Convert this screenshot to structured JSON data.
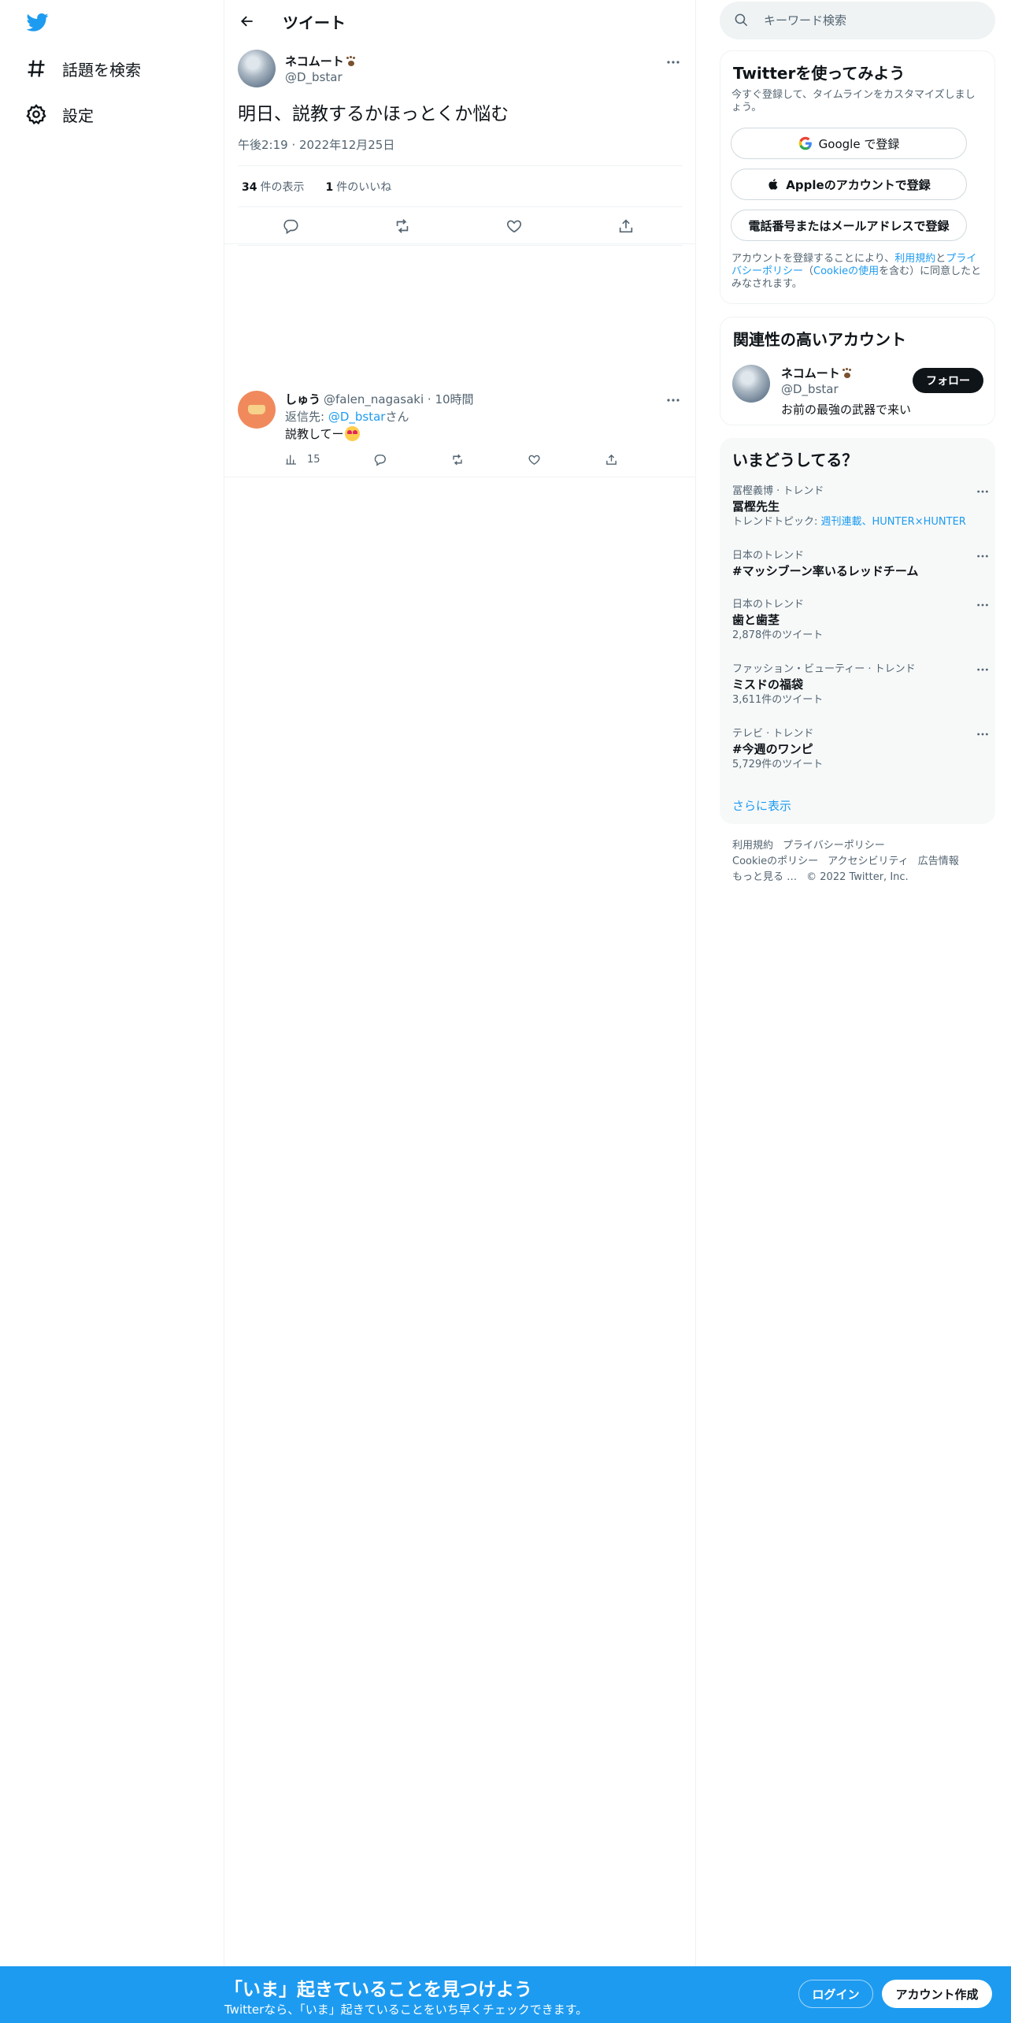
{
  "nav": {
    "items": [
      {
        "label": "話題を検索",
        "icon": "hashtag-icon"
      },
      {
        "label": "設定",
        "icon": "gear-icon"
      }
    ]
  },
  "header": {
    "title": "ツイート"
  },
  "tweet": {
    "display_name": "ネコムート",
    "handle": "@D_bstar",
    "text": "明日、説教するかほっとくか悩む",
    "time": "午後2:19 · 2022年12月25日",
    "views_count": "34",
    "views_label": "件の表示",
    "likes_count": "1",
    "likes_label": "件のいいね"
  },
  "reply": {
    "display_name": "しゅう",
    "handle_time": "@falen_nagasaki · 10時間",
    "reply_to_prefix": "返信先: ",
    "reply_to_handle": "@D_bstar",
    "reply_to_suffix": "さん",
    "text": "説教してー",
    "views": "15"
  },
  "search": {
    "placeholder": "キーワード検索"
  },
  "signup": {
    "title": "Twitterを使ってみよう",
    "subtitle": "今すぐ登録して、タイムラインをカスタマイズしましょう。",
    "google_label": "Google で登録",
    "apple_label": "Appleのアカウントで登録",
    "phone_label": "電話番号またはメールアドレスで登録",
    "legal_1": "アカウントを登録することにより、",
    "legal_terms": "利用規約",
    "legal_2": "と",
    "legal_privacy": "プライバシーポリシー",
    "legal_3": "（",
    "legal_cookie": "Cookieの使用",
    "legal_4": "を含む）に同意したとみなされます。"
  },
  "related": {
    "title": "関連性の高いアカウント",
    "display_name": "ネコムート",
    "handle": "@D_bstar",
    "bio": "お前の最強の武器で来い",
    "follow_label": "フォロー"
  },
  "trends": {
    "title": "いまどうしてる？",
    "items": [
      {
        "meta": "冨樫義博 · トレンド",
        "name": "冨樫先生",
        "count_prefix": "トレンドトピック: ",
        "count_link": "週刊連載、HUNTER×HUNTER"
      },
      {
        "meta": "日本のトレンド",
        "name": "#マッシブーン率いるレッドチーム",
        "count": ""
      },
      {
        "meta": "日本のトレンド",
        "name": "歯と歯茎",
        "count": "2,878件のツイート"
      },
      {
        "meta": "ファッション・ビューティー · トレンド",
        "name": "ミスドの福袋",
        "count": "3,611件のツイート"
      },
      {
        "meta": "テレビ · トレンド",
        "name": "#今週のワンピ",
        "count": "5,729件のツイート"
      }
    ],
    "show_more": "さらに表示"
  },
  "footer": {
    "links": [
      "利用規約",
      "プライバシーポリシー",
      "Cookieのポリシー",
      "アクセシビリティ",
      "広告情報",
      "もっと見る …"
    ],
    "copyright": "© 2022 Twitter, Inc."
  },
  "bottombar": {
    "title": "「いま」起きていることを見つけよう",
    "subtitle": "Twitterなら、「いま」起きていることをいち早くチェックできます。",
    "login_label": "ログイン",
    "signup_label": "アカウント作成"
  },
  "colors": {
    "accent": "#1d9bf0",
    "text": "#0f1419",
    "secondary": "#536471",
    "border": "#eff3f4"
  }
}
